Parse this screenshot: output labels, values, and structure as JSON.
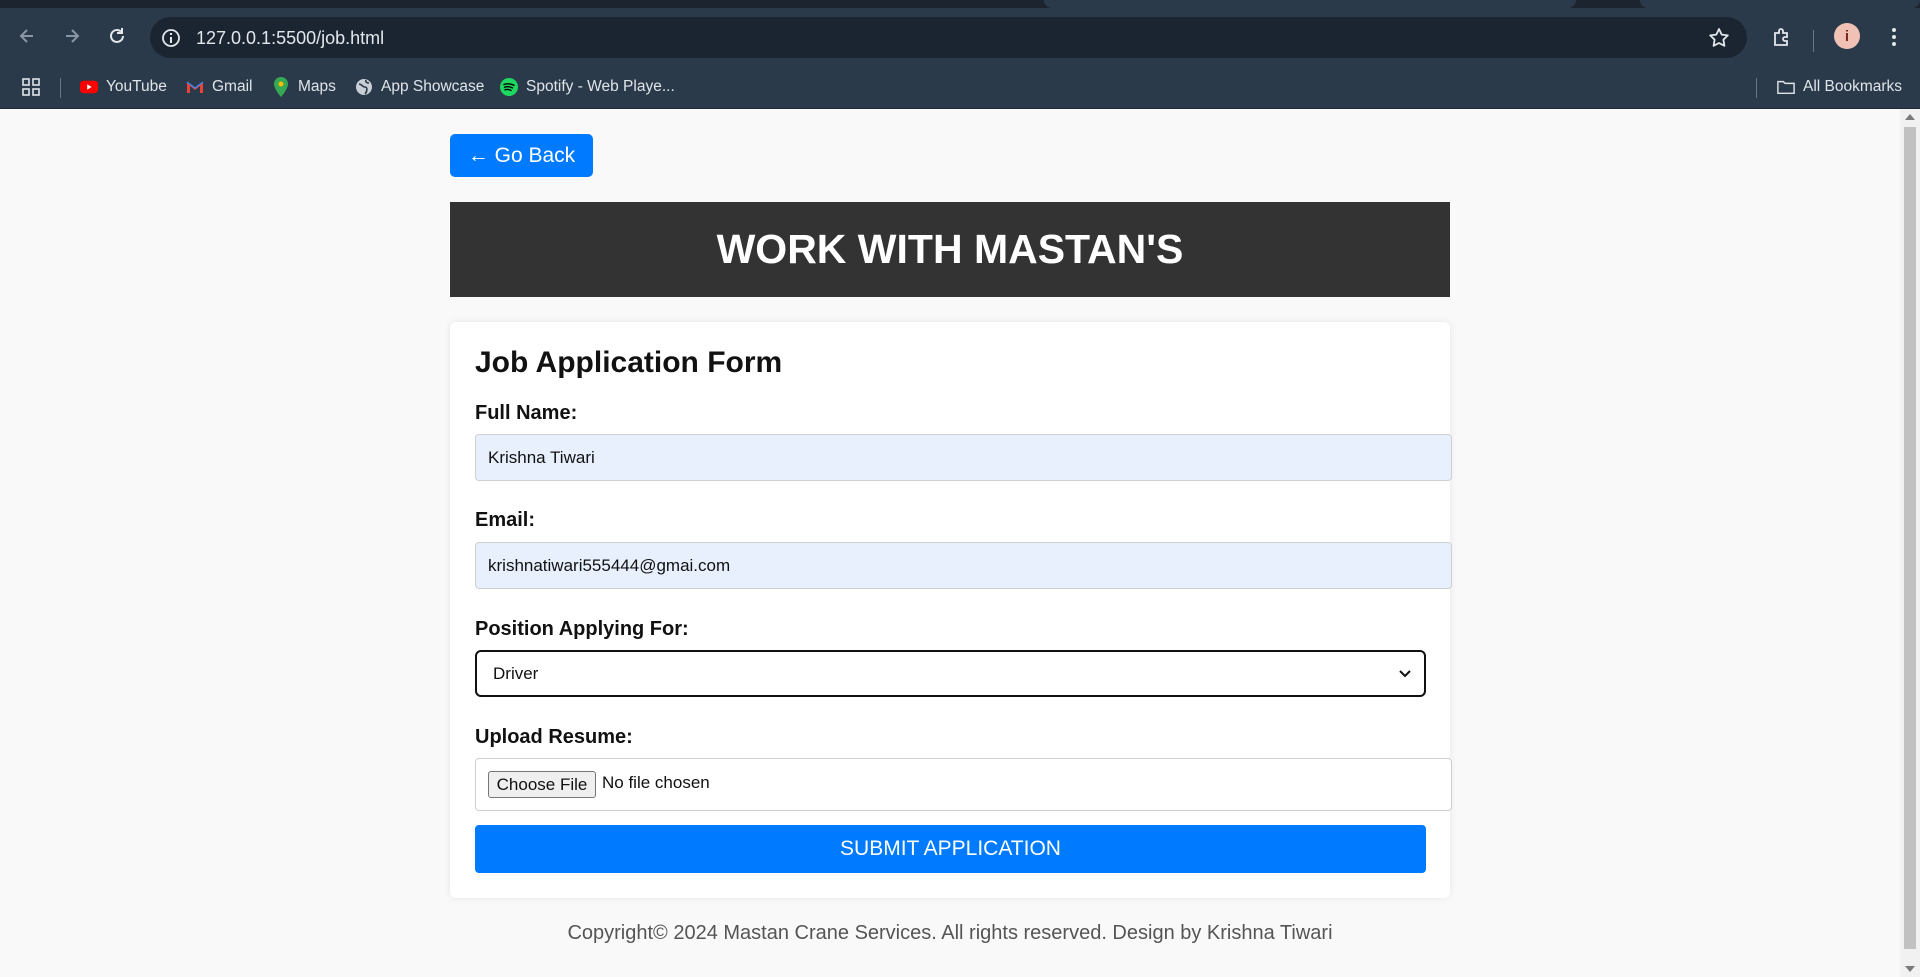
{
  "browser": {
    "url": "127.0.0.1:5500/job.html",
    "bookmarks": [
      {
        "label": "YouTube",
        "icon": "youtube-icon"
      },
      {
        "label": "Gmail",
        "icon": "gmail-icon"
      },
      {
        "label": "Maps",
        "icon": "maps-icon"
      },
      {
        "label": "App Showcase",
        "icon": "globe-icon"
      },
      {
        "label": "Spotify - Web Playe...",
        "icon": "spotify-icon"
      }
    ],
    "all_bookmarks_label": "All Bookmarks",
    "profile_initial": "i"
  },
  "page": {
    "back_button": "← Go Back",
    "banner_title": "WORK WITH MASTAN'S",
    "form": {
      "title": "Job Application Form",
      "full_name_label": "Full Name:",
      "full_name_value": "Krishna Tiwari",
      "email_label": "Email:",
      "email_value": "krishnatiwari555444@gmai.com",
      "position_label": "Position Applying For:",
      "position_value": "Driver",
      "resume_label": "Upload Resume:",
      "choose_file_label": "Choose File",
      "file_status": "No file chosen",
      "submit_label": "SUBMIT APPLICATION"
    },
    "footer": "Copyright© 2024 Mastan Crane Services. All rights reserved. Design by Krishna Tiwari"
  },
  "colors": {
    "primary": "#007bff",
    "banner_bg": "#333333",
    "autofill_bg": "#e8f0fe",
    "chrome_bg": "#2b3a4a"
  }
}
